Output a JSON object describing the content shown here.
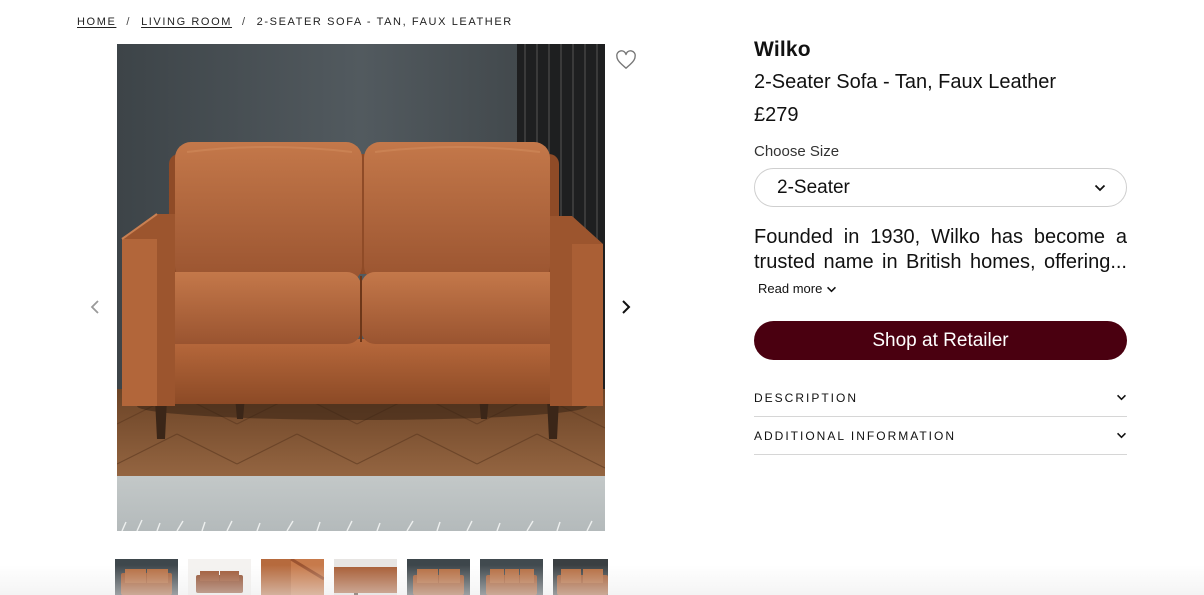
{
  "breadcrumb": {
    "items": [
      "Home",
      "Living Room"
    ],
    "current": "2-Seater Sofa - Tan, Faux Leather",
    "separator": "/"
  },
  "gallery": {
    "main_image": "tan faux leather 2-seater sofa in front of grey wall on herringbone wood floor with grey rug",
    "thumbnail_count": 7
  },
  "product": {
    "brand": "Wilko",
    "name": "2-Seater Sofa - Tan, Faux Leather",
    "price": "£279",
    "size_label": "Choose Size",
    "size_value": "2-Seater",
    "description": "Founded in 1930, Wilko has become a trusted name in British homes, offering...",
    "read_more": "Read more",
    "shop_button": "Shop at Retailer"
  },
  "accordion": {
    "description": "Description",
    "additional": "Additional Information"
  },
  "colors": {
    "shop_button_bg": "#4a0010",
    "sofa_tan": "#a85a32",
    "wall": "#4b5257"
  },
  "icons": {
    "favourite": "heart-outline-icon",
    "prev": "chevron-left-icon",
    "next": "chevron-right-icon",
    "dropdown": "chevron-down-icon"
  }
}
